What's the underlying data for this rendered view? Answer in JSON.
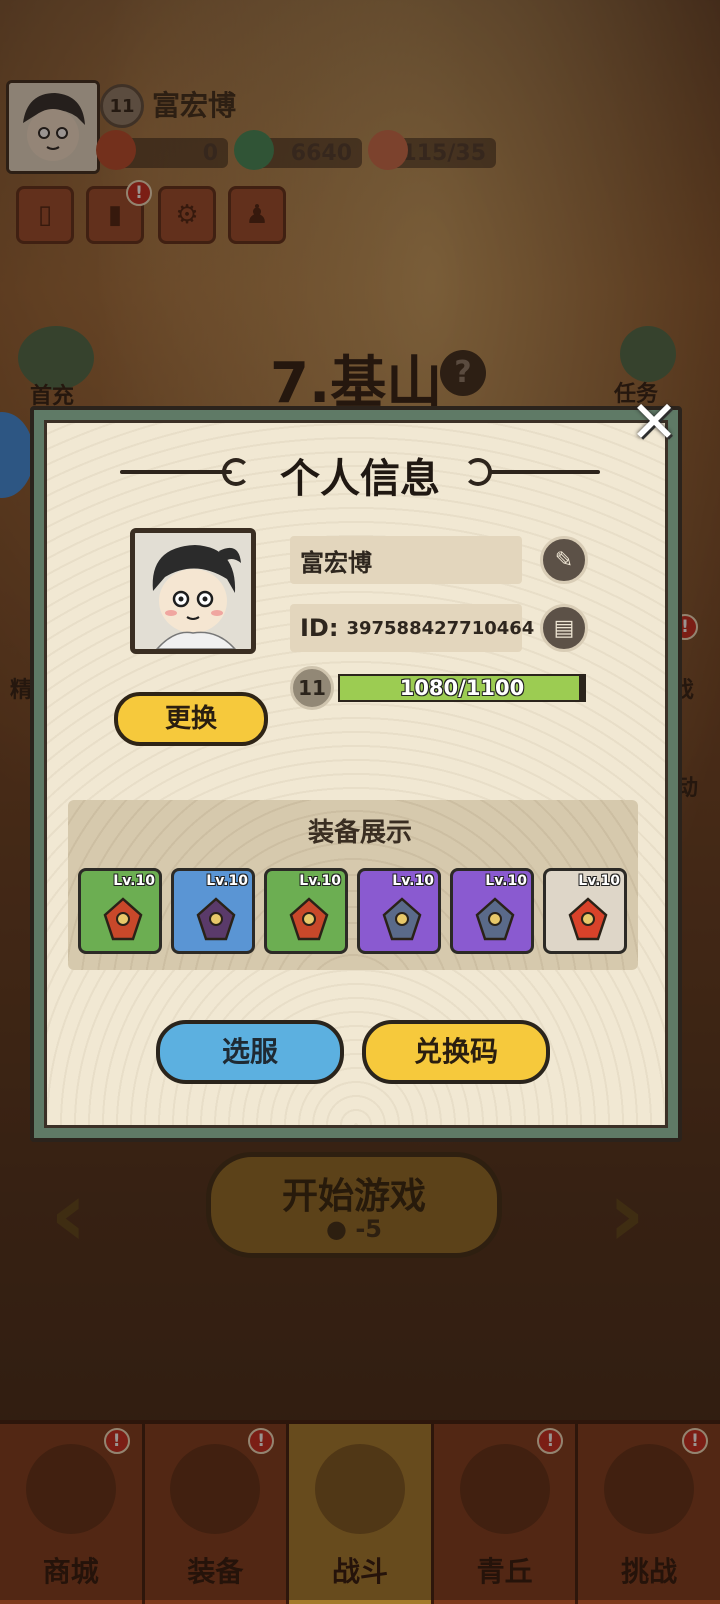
{
  "hud": {
    "player_name": "富宏博",
    "player_level": "11",
    "gems": "0",
    "coins": "6640",
    "stamina": "115/35"
  },
  "top_buttons": [
    {
      "icon": "tickets-icon"
    },
    {
      "icon": "ranking-icon",
      "alert": "!"
    },
    {
      "icon": "settings-icon"
    },
    {
      "icon": "friends-icon"
    }
  ],
  "stage": {
    "title": "7.基山",
    "help": "?"
  },
  "side": {
    "left_label": "首充",
    "right_label": "任务",
    "left_partial": "精",
    "right_partial_1": "戏",
    "right_partial_2": "动"
  },
  "start": {
    "label": "开始游戏",
    "cost": "-5"
  },
  "bottom_nav": [
    {
      "label": "商城",
      "alert": "!"
    },
    {
      "label": "装备",
      "alert": "!"
    },
    {
      "label": "战斗",
      "active": true
    },
    {
      "label": "青丘",
      "alert": "!"
    },
    {
      "label": "挑战",
      "alert": "!"
    }
  ],
  "dialog": {
    "title": "个人信息",
    "close": "✕",
    "name": "富宏博",
    "id_label": "ID:",
    "id_value": "397588427710464",
    "level": "11",
    "xp_text": "1080/1100",
    "xp_fraction": 0.98,
    "change_label": "更换",
    "equip_title": "装备展示",
    "equipment": [
      {
        "level": "Lv.10",
        "rarity": "green",
        "icon": "flower-amulet-icon"
      },
      {
        "level": "Lv.10",
        "rarity": "blue",
        "icon": "helmet-icon"
      },
      {
        "level": "Lv.10",
        "rarity": "green",
        "icon": "bracer-icon"
      },
      {
        "level": "Lv.10",
        "rarity": "purple",
        "icon": "belt-icon"
      },
      {
        "level": "Lv.10",
        "rarity": "purple",
        "icon": "boots-icon"
      },
      {
        "level": "Lv.10",
        "rarity": "white",
        "icon": "orb-icon"
      }
    ],
    "server_label": "选服",
    "code_label": "兑换码"
  },
  "colors": {
    "dialog_frame": "#5f7a66",
    "parchment": "#f1e8d3",
    "xp_fill": "#9ccc52",
    "yellow_button": "#f6c93c",
    "blue_button": "#5cb0e0"
  }
}
